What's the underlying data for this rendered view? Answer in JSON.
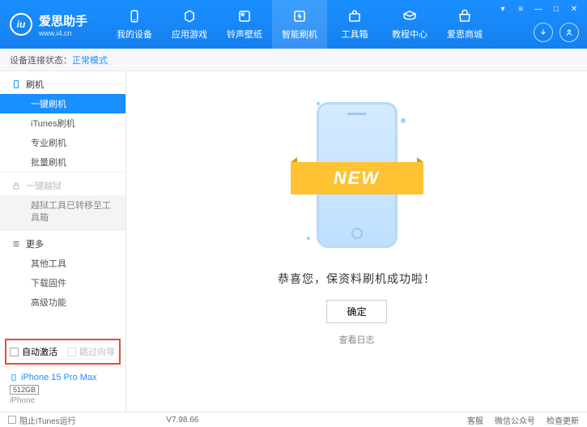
{
  "app": {
    "title": "爱思助手",
    "url": "www.i4.cn"
  },
  "nav": [
    {
      "label": "我的设备"
    },
    {
      "label": "应用游戏"
    },
    {
      "label": "铃声壁纸"
    },
    {
      "label": "智能刷机"
    },
    {
      "label": "工具箱"
    },
    {
      "label": "教程中心"
    },
    {
      "label": "爱思商城"
    }
  ],
  "status": {
    "label": "设备连接状态：",
    "mode": "正常模式"
  },
  "sidebar": {
    "flash": {
      "title": "刷机",
      "items": [
        "一键刷机",
        "iTunes刷机",
        "专业刷机",
        "批量刷机"
      ]
    },
    "jailbreak": {
      "title": "一键越狱",
      "msg": "越狱工具已转移至工具箱"
    },
    "more": {
      "title": "更多",
      "items": [
        "其他工具",
        "下载固件",
        "高级功能"
      ]
    },
    "checkboxes": {
      "auto": "自动激活",
      "skip": "跳过向导"
    },
    "device": {
      "name": "iPhone 15 Pro Max",
      "capacity": "512GB",
      "type": "iPhone"
    }
  },
  "main": {
    "ribbon": "NEW",
    "success": "恭喜您，保资料刷机成功啦！",
    "ok": "确定",
    "viewLog": "查看日志"
  },
  "footer": {
    "blockItunes": "阻止iTunes运行",
    "version": "V7.98.66",
    "links": [
      "客服",
      "微信公众号",
      "检查更新"
    ]
  }
}
